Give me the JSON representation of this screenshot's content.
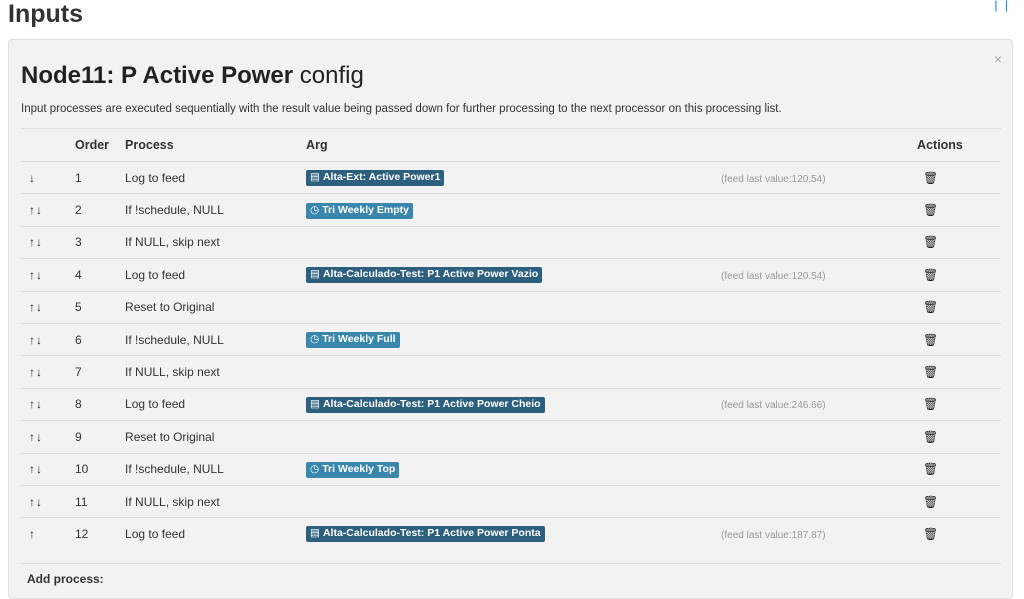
{
  "page": {
    "title": "Inputs",
    "top_links": "| |"
  },
  "modal": {
    "close": "×",
    "title_bold": "Node11: P Active Power",
    "title_rest": "config",
    "description": "Input processes are executed sequentially with the result value being passed down for further processing to the next processor on this processing list.",
    "add_process_label": "Add process:"
  },
  "table": {
    "headers": {
      "order": "Order",
      "process": "Process",
      "arg": "Arg",
      "actions": "Actions"
    },
    "rows": [
      {
        "arrows": "↓",
        "order": "1",
        "process": "Log to feed",
        "arg": "Alta-Ext: Active Power1",
        "arg_type": "feed",
        "last": "(feed last value:120.54)"
      },
      {
        "arrows": "↑↓",
        "order": "2",
        "process": "If !schedule, NULL",
        "arg": "Tri Weekly Empty",
        "arg_type": "schedule",
        "last": ""
      },
      {
        "arrows": "↑↓",
        "order": "3",
        "process": "If NULL, skip next",
        "arg": "",
        "arg_type": "",
        "last": ""
      },
      {
        "arrows": "↑↓",
        "order": "4",
        "process": "Log to feed",
        "arg": "Alta-Calculado-Test: P1 Active Power Vazio",
        "arg_type": "feed",
        "last": "(feed last value:120.54)"
      },
      {
        "arrows": "↑↓",
        "order": "5",
        "process": "Reset to Original",
        "arg": "",
        "arg_type": "",
        "last": ""
      },
      {
        "arrows": "↑↓",
        "order": "6",
        "process": "If !schedule, NULL",
        "arg": "Tri Weekly Full",
        "arg_type": "schedule",
        "last": ""
      },
      {
        "arrows": "↑↓",
        "order": "7",
        "process": "If NULL, skip next",
        "arg": "",
        "arg_type": "",
        "last": ""
      },
      {
        "arrows": "↑↓",
        "order": "8",
        "process": "Log to feed",
        "arg": "Alta-Calculado-Test: P1 Active Power Cheio",
        "arg_type": "feed",
        "last": "(feed last value:246.66)"
      },
      {
        "arrows": "↑↓",
        "order": "9",
        "process": "Reset to Original",
        "arg": "",
        "arg_type": "",
        "last": ""
      },
      {
        "arrows": "↑↓",
        "order": "10",
        "process": "If !schedule, NULL",
        "arg": "Tri Weekly Top",
        "arg_type": "schedule",
        "last": ""
      },
      {
        "arrows": "↑↓",
        "order": "11",
        "process": "If NULL, skip next",
        "arg": "",
        "arg_type": "",
        "last": ""
      },
      {
        "arrows": "↑",
        "order": "12",
        "process": "Log to feed",
        "arg": "Alta-Calculado-Test: P1 Active Power Ponta",
        "arg_type": "feed",
        "last": "(feed last value:187.87)"
      }
    ]
  },
  "icons": {
    "feed": "feed-table-icon",
    "schedule": "clock-icon",
    "delete": "trash-icon"
  },
  "colors": {
    "feed_badge": "#2d5f7e",
    "schedule_badge": "#3a87ad",
    "modal_bg": "#f2f2f2"
  }
}
